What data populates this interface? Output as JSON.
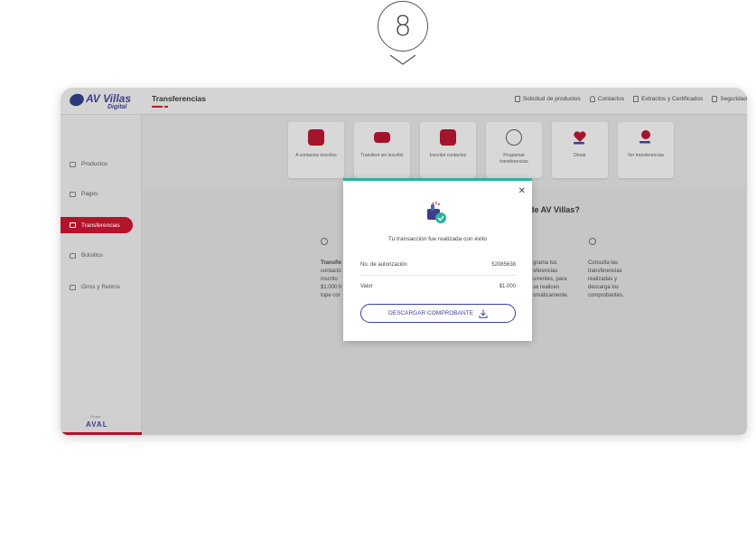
{
  "step": {
    "number": "8"
  },
  "header": {
    "logo_text": "AV Villas",
    "logo_sub": "Digital",
    "page_title": "Transferencias",
    "nav": [
      {
        "label": "Solicitud de productos",
        "icon": "document-icon"
      },
      {
        "label": "Contactos",
        "icon": "person-icon"
      },
      {
        "label": "Extractos y Certificados",
        "icon": "file-icon"
      },
      {
        "label": "Seguridad",
        "icon": "lock-icon"
      }
    ]
  },
  "sidebar": {
    "items": [
      {
        "label": "Productos",
        "icon": "wallet-icon",
        "active": false
      },
      {
        "label": "Pagos",
        "icon": "card-icon",
        "active": false
      },
      {
        "label": "Transferencias",
        "icon": "transfer-icon",
        "active": true
      },
      {
        "label": "Bolsillos",
        "icon": "pocket-icon",
        "active": false
      },
      {
        "label": "Giros y Retiros",
        "icon": "cash-icon",
        "active": false
      }
    ],
    "footer_brand": "AVAL",
    "footer_sub": "Grupo"
  },
  "tiles": [
    {
      "label": "A contactos inscritos",
      "icon": "contacts-phone-icon"
    },
    {
      "label": "Transferir sin inscribir",
      "icon": "money-transfer-icon"
    },
    {
      "label": "Inscribir contactos",
      "icon": "register-contact-icon"
    },
    {
      "label": "Programar transferencias",
      "icon": "money-bag-icon"
    },
    {
      "label": "Donar",
      "icon": "heart-hand-icon"
    },
    {
      "label": "Ver transferencias",
      "icon": "coin-hand-icon"
    }
  ],
  "background_section": {
    "heading": "de AV Villas?",
    "col1": {
      "head": "Transfie",
      "lines": [
        "contacto",
        "inscrito",
        "$1.000 h",
        "tope cor"
      ]
    },
    "col2": {
      "lines": [
        "grama tus",
        "sferencias",
        "urrentes, para",
        "se realicen",
        "omáticamente."
      ]
    },
    "col3": {
      "lines": [
        "Consulta las",
        "transferencias",
        "realizadas y",
        "descarga los",
        "comprobantes."
      ]
    }
  },
  "modal": {
    "message": "Tu transacción fue realizada con éxito",
    "rows": [
      {
        "label": "No. de autorización",
        "value": "52085638"
      },
      {
        "label": "Valor",
        "value": "$1.000"
      }
    ],
    "download_label": "DESCARGAR COMPROBANTE",
    "accent_color": "#2bb39a",
    "button_color": "#3a3f9a"
  },
  "colors": {
    "brand_red": "#b3132b",
    "brand_blue": "#3a3f8a"
  }
}
